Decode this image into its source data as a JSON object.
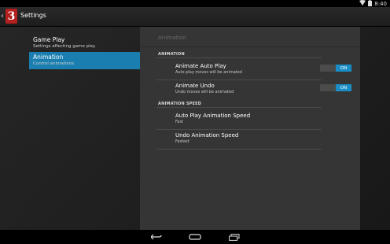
{
  "status_bar": {
    "time": "8:40",
    "icons": [
      "wifi-icon",
      "battery-icon"
    ]
  },
  "action_bar": {
    "title": "Settings",
    "app_icon_text": "3"
  },
  "left_list": [
    {
      "label": "Game Play",
      "sub": "Settings affecting game play",
      "selected": false
    },
    {
      "label": "Animation",
      "sub": "Control animations",
      "selected": true
    }
  ],
  "panel": {
    "title": "Animation",
    "sections": [
      {
        "header": "ANIMATION"
      },
      {
        "header": "ANIMATION SPEED"
      }
    ],
    "rows": [
      {
        "label": "Animate Auto Play",
        "sub": "Auto play moves will be animated",
        "toggle": "ON"
      },
      {
        "label": "Animate Undo",
        "sub": "Undo moves will be animated",
        "toggle": "ON"
      },
      {
        "label": "Auto Play Animation Speed",
        "sub": "Fast"
      },
      {
        "label": "Undo Animation Speed",
        "sub": "Fastest"
      }
    ]
  },
  "colors": {
    "accent": "#1a8dc6",
    "selected_bg": "#1a7fb0",
    "app_icon": "#b3201e"
  }
}
